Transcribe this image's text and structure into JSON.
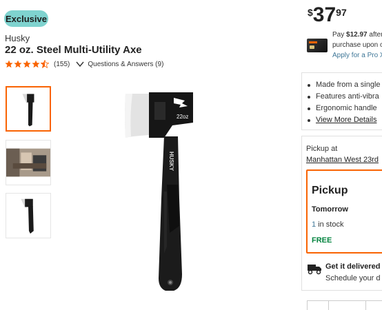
{
  "product": {
    "badge": "Exclusive",
    "brand": "Husky",
    "title": "22 oz. Steel Multi-Utility Axe",
    "rating": 4.5,
    "review_count": "(155)",
    "qa_label": "Questions & Answers (9)"
  },
  "price": {
    "currency": "$",
    "dollars": "37",
    "cents": "97"
  },
  "promo": {
    "line1_prefix": "Pay ",
    "line1_amount": "$12.97",
    "line1_suffix": " after",
    "line2": "purchase upon o",
    "link": "Apply for a Pro X"
  },
  "features": {
    "items": [
      "Made from a single",
      "Features anti-vibra",
      "Ergonomic handle"
    ],
    "more_link": "View More Details"
  },
  "fulfillment": {
    "pickup_at_label": "Pickup at",
    "store": "Manhattan West 23rd",
    "pickup_title": "Pickup",
    "when": "Tomorrow",
    "stock_count": "1",
    "stock_label": " in stock",
    "price_label": "FREE",
    "delivery_title": "Get it delivered",
    "delivery_sub": "Schedule your d"
  },
  "thumbnails": [
    {
      "label": "axe-front-thumbnail"
    },
    {
      "label": "axe-in-use-thumbnail"
    },
    {
      "label": "axe-angle-thumbnail"
    }
  ],
  "main_image": {
    "head_text": "22oz",
    "handle_text": "HUSKY"
  },
  "colors": {
    "accent": "#f96302",
    "badge": "#7fd3cf",
    "link": "#3e7697",
    "free": "#00833e"
  }
}
